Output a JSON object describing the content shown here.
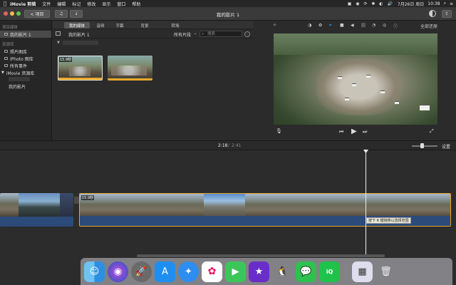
{
  "menubar": {
    "apple": "",
    "items": [
      "iMovie 剪辑",
      "文件",
      "编辑",
      "标记",
      "修改",
      "显示",
      "窗口",
      "帮助"
    ],
    "date": "7月26日 周日",
    "time": "10:38"
  },
  "toolbar": {
    "back_label": "< 项目",
    "title": "我的影片 1"
  },
  "library": {
    "section1": "项目媒体",
    "project": "我的影片 1",
    "section2": "资源库",
    "items": [
      "照片图库",
      "iPhoto 图库",
      "所有事件"
    ],
    "imovie_lib": "iMovie 资源库",
    "my_movie": "我的影片"
  },
  "browser": {
    "tabs": [
      "我的媒体",
      "音频",
      "字幕",
      "背景",
      "转场"
    ],
    "path": "我的影片 1",
    "filter": "所有片段",
    "search_placeholder": "搜索",
    "clip1_dur": "15.9秒"
  },
  "viewer": {
    "reset_label": "全部还原"
  },
  "timeline": {
    "current": "2:18",
    "total": "2:41",
    "settings": "设置",
    "clip_dur": "15.9秒",
    "tooltip": "按下 R 键拖移以选择范围"
  },
  "dock": {
    "apps": [
      "finder",
      "siri",
      "launchpad",
      "app-store",
      "safari",
      "photos",
      "facetime",
      "imovie",
      "qq",
      "wechat",
      "iqiyi",
      "preview",
      "trash"
    ]
  }
}
